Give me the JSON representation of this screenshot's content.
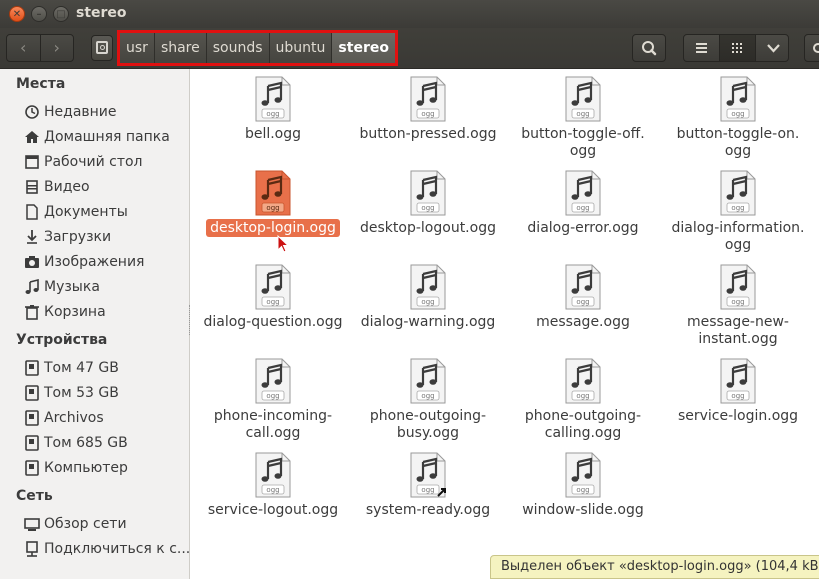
{
  "window": {
    "title": "stereo"
  },
  "toolbar": {
    "path": [
      "usr",
      "share",
      "sounds",
      "ubuntu",
      "stereo"
    ]
  },
  "sidebar": {
    "places_header": "Места",
    "places": [
      {
        "label": "Недавние",
        "icon": "clock-icon"
      },
      {
        "label": "Домашняя папка",
        "icon": "home-icon"
      },
      {
        "label": "Рабочий стол",
        "icon": "desktop-icon"
      },
      {
        "label": "Видео",
        "icon": "video-icon"
      },
      {
        "label": "Документы",
        "icon": "document-icon"
      },
      {
        "label": "Загрузки",
        "icon": "download-icon"
      },
      {
        "label": "Изображения",
        "icon": "camera-icon"
      },
      {
        "label": "Музыка",
        "icon": "music-icon"
      },
      {
        "label": "Корзина",
        "icon": "trash-icon"
      }
    ],
    "devices_header": "Устройства",
    "devices": [
      {
        "label": "Том 47 GB",
        "icon": "drive-icon"
      },
      {
        "label": "Том 53 GB",
        "icon": "drive-icon"
      },
      {
        "label": "Archivos",
        "icon": "drive-icon"
      },
      {
        "label": "Том 685 GB",
        "icon": "drive-icon"
      },
      {
        "label": "Компьютер",
        "icon": "computer-icon"
      }
    ],
    "network_header": "Сеть",
    "network": [
      {
        "label": "Обзор сети",
        "icon": "network-icon"
      },
      {
        "label": "Подключиться к с...",
        "icon": "connect-icon"
      }
    ]
  },
  "files": [
    {
      "line1": "bell.ogg",
      "line2": ""
    },
    {
      "line1": "button-pressed.ogg",
      "line2": ""
    },
    {
      "line1": "button-toggle-off.",
      "line2": "ogg"
    },
    {
      "line1": "button-toggle-on.",
      "line2": "ogg"
    },
    {
      "line1": "desktop-login.ogg",
      "line2": "",
      "selected": true
    },
    {
      "line1": "desktop-logout.ogg",
      "line2": ""
    },
    {
      "line1": "dialog-error.ogg",
      "line2": ""
    },
    {
      "line1": "dialog-information.",
      "line2": "ogg"
    },
    {
      "line1": "dialog-question.ogg",
      "line2": ""
    },
    {
      "line1": "dialog-warning.ogg",
      "line2": ""
    },
    {
      "line1": "message.ogg",
      "line2": ""
    },
    {
      "line1": "message-new-",
      "line2": "instant.ogg"
    },
    {
      "line1": "phone-incoming-",
      "line2": "call.ogg"
    },
    {
      "line1": "phone-outgoing-",
      "line2": "busy.ogg"
    },
    {
      "line1": "phone-outgoing-",
      "line2": "calling.ogg"
    },
    {
      "line1": "service-login.ogg",
      "line2": ""
    },
    {
      "line1": "service-logout.ogg",
      "line2": ""
    },
    {
      "line1": "system-ready.ogg",
      "line2": "",
      "symlink": true
    },
    {
      "line1": "window-slide.ogg",
      "line2": ""
    }
  ],
  "icon_tag": "ogg",
  "status": {
    "text": "Выделен объект «desktop-login.ogg» (104,4 kB"
  },
  "colors": {
    "selection": "#e8704a",
    "titlebar": "#3c3b37",
    "highlight_box": "#e01010"
  }
}
